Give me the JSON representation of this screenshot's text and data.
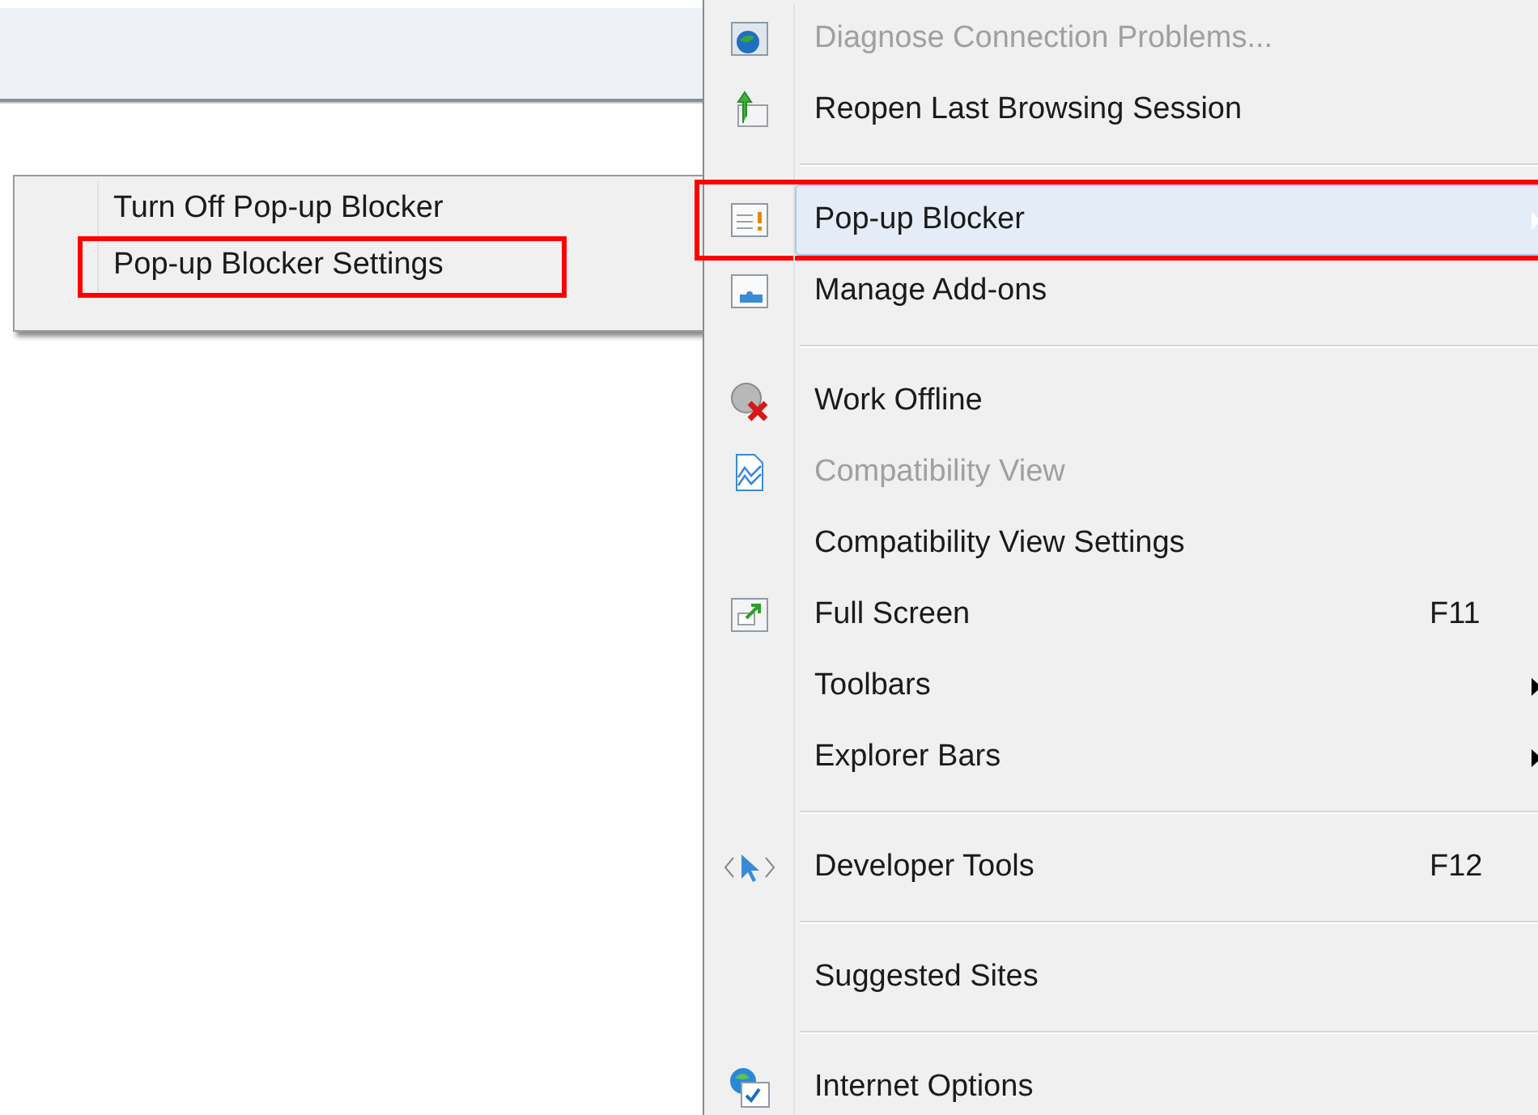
{
  "menu": {
    "items": [
      {
        "kind": "item",
        "label": "Diagnose Connection Problems...",
        "disabled": true,
        "selected": false,
        "submenu": false,
        "annotated": false
      },
      {
        "kind": "item",
        "label": "Reopen Last Browsing Session",
        "disabled": false,
        "selected": false,
        "submenu": false,
        "annotated": false
      },
      {
        "kind": "separator"
      },
      {
        "kind": "item",
        "label": "Pop-up Blocker",
        "disabled": false,
        "selected": true,
        "submenu": true,
        "annotated": true
      },
      {
        "kind": "item",
        "label": "Manage Add-ons",
        "disabled": false,
        "selected": false,
        "submenu": false,
        "annotated": false
      },
      {
        "kind": "separator"
      },
      {
        "kind": "item",
        "label": "Work Offline",
        "disabled": false,
        "selected": false,
        "submenu": false,
        "annotated": false
      },
      {
        "kind": "item",
        "label": "Compatibility View",
        "disabled": true,
        "selected": false,
        "submenu": false,
        "annotated": false
      },
      {
        "kind": "item",
        "label": "Compatibility View Settings",
        "disabled": false,
        "selected": false,
        "submenu": false,
        "annotated": false
      },
      {
        "kind": "item",
        "label": "Full Screen",
        "shortcut": "F11",
        "disabled": false,
        "selected": false,
        "submenu": false,
        "annotated": false
      },
      {
        "kind": "item",
        "label": "Toolbars",
        "disabled": false,
        "selected": false,
        "submenu": true,
        "annotated": false
      },
      {
        "kind": "item",
        "label": "Explorer Bars",
        "disabled": false,
        "selected": false,
        "submenu": true,
        "annotated": false
      },
      {
        "kind": "separator"
      },
      {
        "kind": "item",
        "label": "Developer Tools",
        "shortcut": "F12",
        "disabled": false,
        "selected": false,
        "submenu": false,
        "annotated": false
      },
      {
        "kind": "separator"
      },
      {
        "kind": "item",
        "label": "Suggested Sites",
        "disabled": false,
        "selected": false,
        "submenu": false,
        "annotated": false
      },
      {
        "kind": "separator"
      },
      {
        "kind": "item",
        "label": "Internet Options",
        "disabled": false,
        "selected": false,
        "submenu": false,
        "annotated": false
      }
    ]
  },
  "submenu": {
    "items": [
      {
        "label": "Turn Off Pop-up Blocker",
        "annotated": false
      },
      {
        "label": "Pop-up Blocker Settings",
        "annotated": true
      }
    ]
  }
}
